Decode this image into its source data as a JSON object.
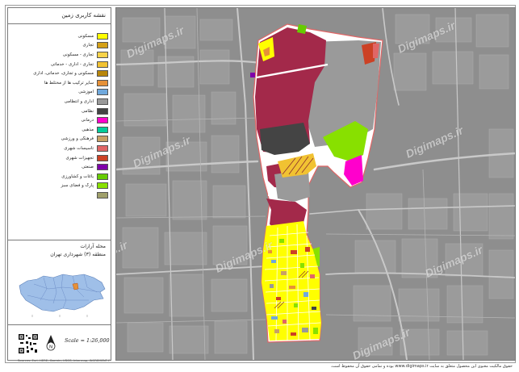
{
  "legend": {
    "title": "نقشه کاربری زمین",
    "items": [
      {
        "label": "مسکونی",
        "color": "#ffff00"
      },
      {
        "label": "تجاری",
        "color": "#d4a017"
      },
      {
        "label": "تجاری - مسکونی",
        "color": "#f7d34a"
      },
      {
        "label": "تجاری - اداری - خدماتی",
        "color": "#f1c232"
      },
      {
        "label": "مسکونی و تجاری، خدماتی، اداری",
        "color": "#b8860b"
      },
      {
        "label": "سایر ترکیب ها از مختلط ها",
        "color": "#e69138"
      },
      {
        "label": "آموزشی",
        "color": "#6fa8dc"
      },
      {
        "label": "اداری و انتظامی",
        "color": "#999999"
      },
      {
        "label": "نظامی",
        "color": "#444444"
      },
      {
        "label": "درمانی",
        "color": "#ff00cc"
      },
      {
        "label": "مذهبی",
        "color": "#00cc99"
      },
      {
        "label": "فرهنگی و ورزشی",
        "color": "#c8a165"
      },
      {
        "label": "تاسیسات شهری",
        "color": "#e06666"
      },
      {
        "label": "تجهیزات شهری",
        "color": "#cc4125"
      },
      {
        "label": "صنعتی",
        "color": "#7f00aa"
      },
      {
        "label": "باغات و کشاورزی",
        "color": "#66cc00"
      },
      {
        "label": "پارک و فضای سبز",
        "color": "#88e000"
      },
      {
        "label": "",
        "color": "#a0a06b"
      }
    ]
  },
  "district": {
    "title": "محله آرارات",
    "subtitle": "منطقه (۳) شهرداری تهران"
  },
  "scale_text": "Scale = 1:26,000",
  "north_label": "N",
  "footnote": "Sources: Esri, HERE, Garmin, USGS, Intermap, INCREMENT P",
  "watermark": "Digimaps.ir",
  "footer": "حقوق مالکیت معنوی این محصول متعلق به سایت www.digimaps.ir بوده و تمامی حقوق آن محفوظ است."
}
